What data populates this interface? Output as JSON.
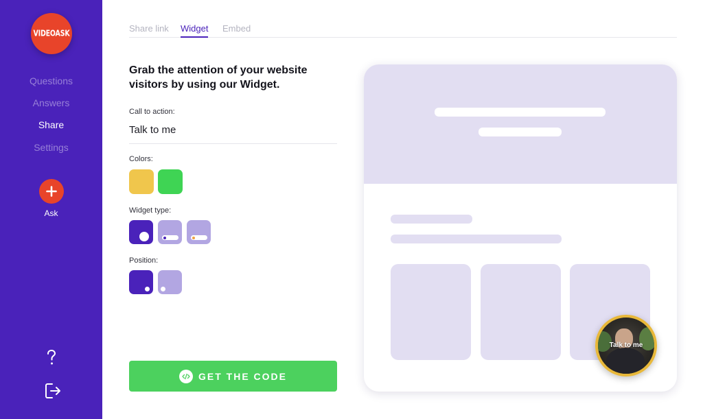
{
  "sidebar": {
    "logo_text": "VIDEOASK",
    "nav": [
      {
        "label": "Questions",
        "active": false
      },
      {
        "label": "Answers",
        "active": false
      },
      {
        "label": "Share",
        "active": true
      },
      {
        "label": "Settings",
        "active": false
      }
    ],
    "ask_label": "Ask",
    "icons": {
      "ask": "plus-icon",
      "help": "question-mark-icon",
      "logout": "logout-icon"
    }
  },
  "tabs": [
    {
      "label": "Share link",
      "active": false
    },
    {
      "label": "Widget",
      "active": true
    },
    {
      "label": "Embed",
      "active": false
    }
  ],
  "form": {
    "headline": "Grab the attention of your website visitors by using our Widget.",
    "cta_label": "Call to action:",
    "cta_value": "Talk to me",
    "colors_label": "Colors:",
    "colors": [
      "#f0c64c",
      "#3fd454"
    ],
    "widget_type_label": "Widget type:",
    "widget_type_selected": 0,
    "position_label": "Position:",
    "position_selected": 0,
    "get_code_label": "GET THE CODE",
    "get_code_icon": "code-icon"
  },
  "preview": {
    "bubble_label": "Talk to me"
  },
  "colors": {
    "brand": "#4a22ba",
    "accent_red": "#e8442a",
    "cta_green": "#4cd15e",
    "preview_lavender": "#e2def2",
    "bubble_border": "#e8b83a"
  }
}
